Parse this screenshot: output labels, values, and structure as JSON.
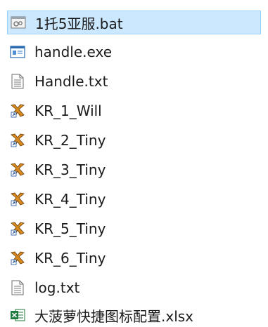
{
  "files": [
    {
      "name": "1托5亚服.bat",
      "icon": "batch-file-icon",
      "selected": true
    },
    {
      "name": "handle.exe",
      "icon": "application-window-icon",
      "selected": false
    },
    {
      "name": "Handle.txt",
      "icon": "text-document-icon",
      "selected": false
    },
    {
      "name": "KR_1_Will",
      "icon": "shortcut-app-icon",
      "selected": false
    },
    {
      "name": "KR_2_Tiny",
      "icon": "shortcut-app-icon",
      "selected": false
    },
    {
      "name": "KR_3_Tiny",
      "icon": "shortcut-app-icon",
      "selected": false
    },
    {
      "name": "KR_4_Tiny",
      "icon": "shortcut-app-icon",
      "selected": false
    },
    {
      "name": "KR_5_Tiny",
      "icon": "shortcut-app-icon",
      "selected": false
    },
    {
      "name": "KR_6_Tiny",
      "icon": "shortcut-app-icon",
      "selected": false
    },
    {
      "name": "log.txt",
      "icon": "text-document-icon",
      "selected": false
    },
    {
      "name": "大菠萝快捷图标配置.xlsx",
      "icon": "excel-file-icon",
      "selected": false
    }
  ],
  "colors": {
    "selection_bg": "#cce8ff",
    "selection_border": "#99d1ff",
    "excel_green": "#1f7a3f",
    "exe_blue": "#2b6cb0",
    "shortcut_orange": "#d98a1f"
  }
}
